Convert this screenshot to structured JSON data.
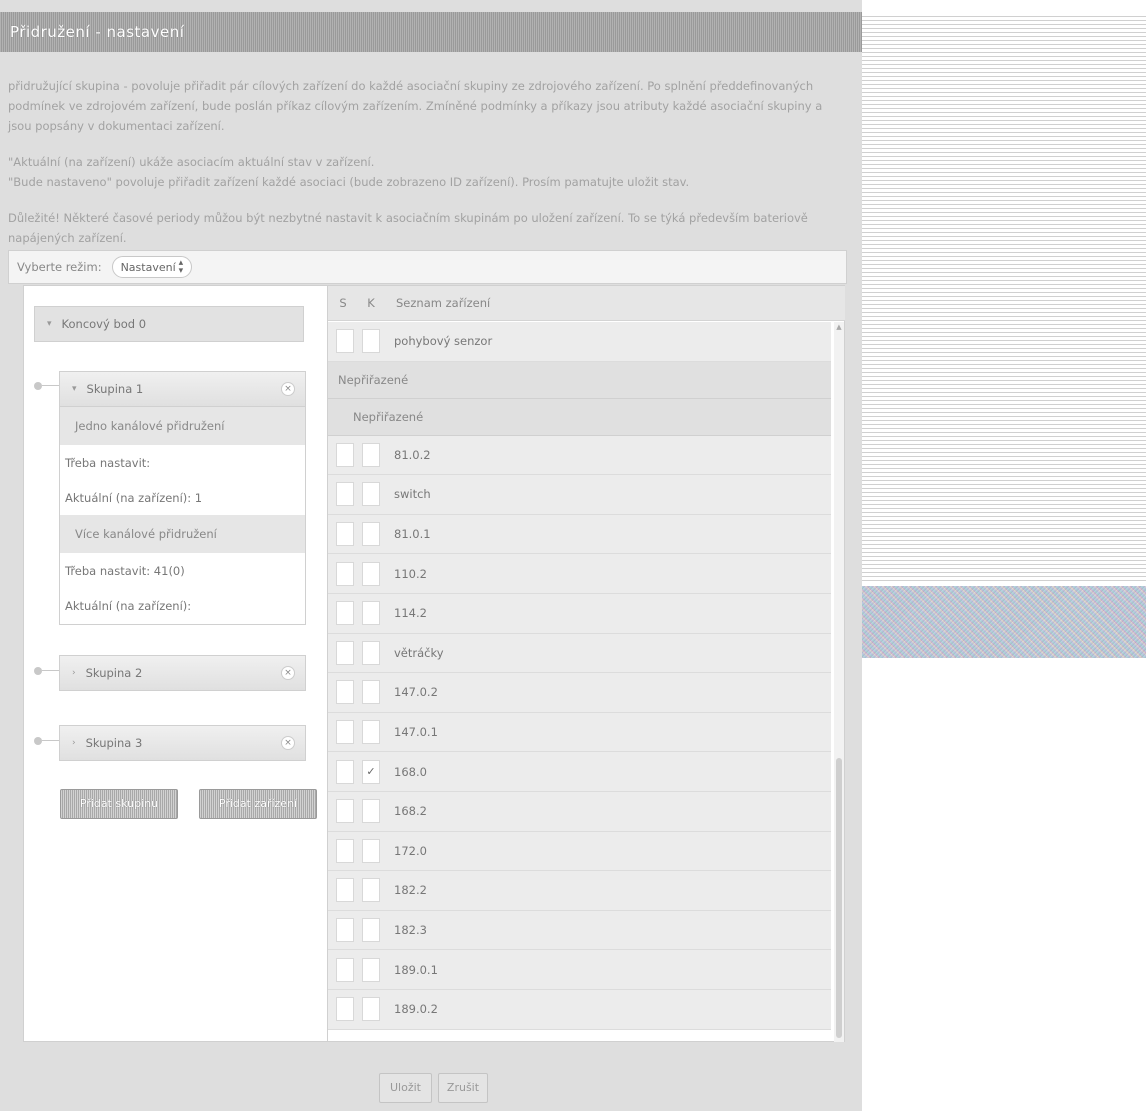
{
  "header": {
    "title": "Přidružení - nastavení"
  },
  "intro": {
    "paragraph1": "přidružující skupina - povoluje přiřadit pár cílových zařízení do každé asociační skupiny ze zdrojového zařízení. Po splnění předdefinovaných podmínek ve zdrojovém zařízení, bude poslán příkaz cílovým zařízením. Zmíněné podmínky a příkazy jsou atributy každé asociační skupiny a jsou popsány v dokumentaci zařízení.",
    "paragraph2a": "\"Aktuální (na zařízení) ukáže asociacím aktuální stav v zařízení.",
    "paragraph2b": "\"Bude nastaveno\" povoluje přiřadit zařízení každé asociaci (bude zobrazeno ID zařízení). Prosím pamatujte uložit stav.",
    "paragraph3": "Důležité! Některé časové periody můžou být nezbytné nastavit k asociačním skupinám po uložení zařízení. To se týká především bateriově napájených zařízení."
  },
  "mode": {
    "label": "Vyberte režim:",
    "value": "Nastavení"
  },
  "endpoint": {
    "label": "Koncový bod 0"
  },
  "groups": {
    "g1": {
      "label": "Skupina 1",
      "single_title": "Jedno kanálové přidružení",
      "single_required": "Třeba nastavit:",
      "single_current": "Aktuální (na zařízení): 1",
      "multi_title": "Více kanálové přidružení",
      "multi_required": "Třeba nastavit: 41(0)",
      "multi_current": "Aktuální (na zařízení):"
    },
    "g2": {
      "label": "Skupina 2"
    },
    "g3": {
      "label": "Skupina 3"
    }
  },
  "buttons": {
    "add_group": "Přidat skupinu",
    "add_device": "Přidat zařízení",
    "save": "Uložit",
    "cancel": "Zrušit"
  },
  "device_list": {
    "col_s": "S",
    "col_k": "K",
    "col_name": "Seznam zařízení",
    "first_device": "pohybový senzor",
    "section_unassigned": "Nepřiřazené",
    "subsection_unassigned": "Nepřiřazené",
    "devices": [
      "81.0.2",
      "switch",
      "81.0.1",
      "110.2",
      "114.2",
      "větráčky",
      "147.0.2",
      "147.0.1",
      "168.0",
      "168.2",
      "172.0",
      "182.2",
      "182.3",
      "189.0.1",
      "189.0.2"
    ],
    "check_mark": "✓"
  }
}
